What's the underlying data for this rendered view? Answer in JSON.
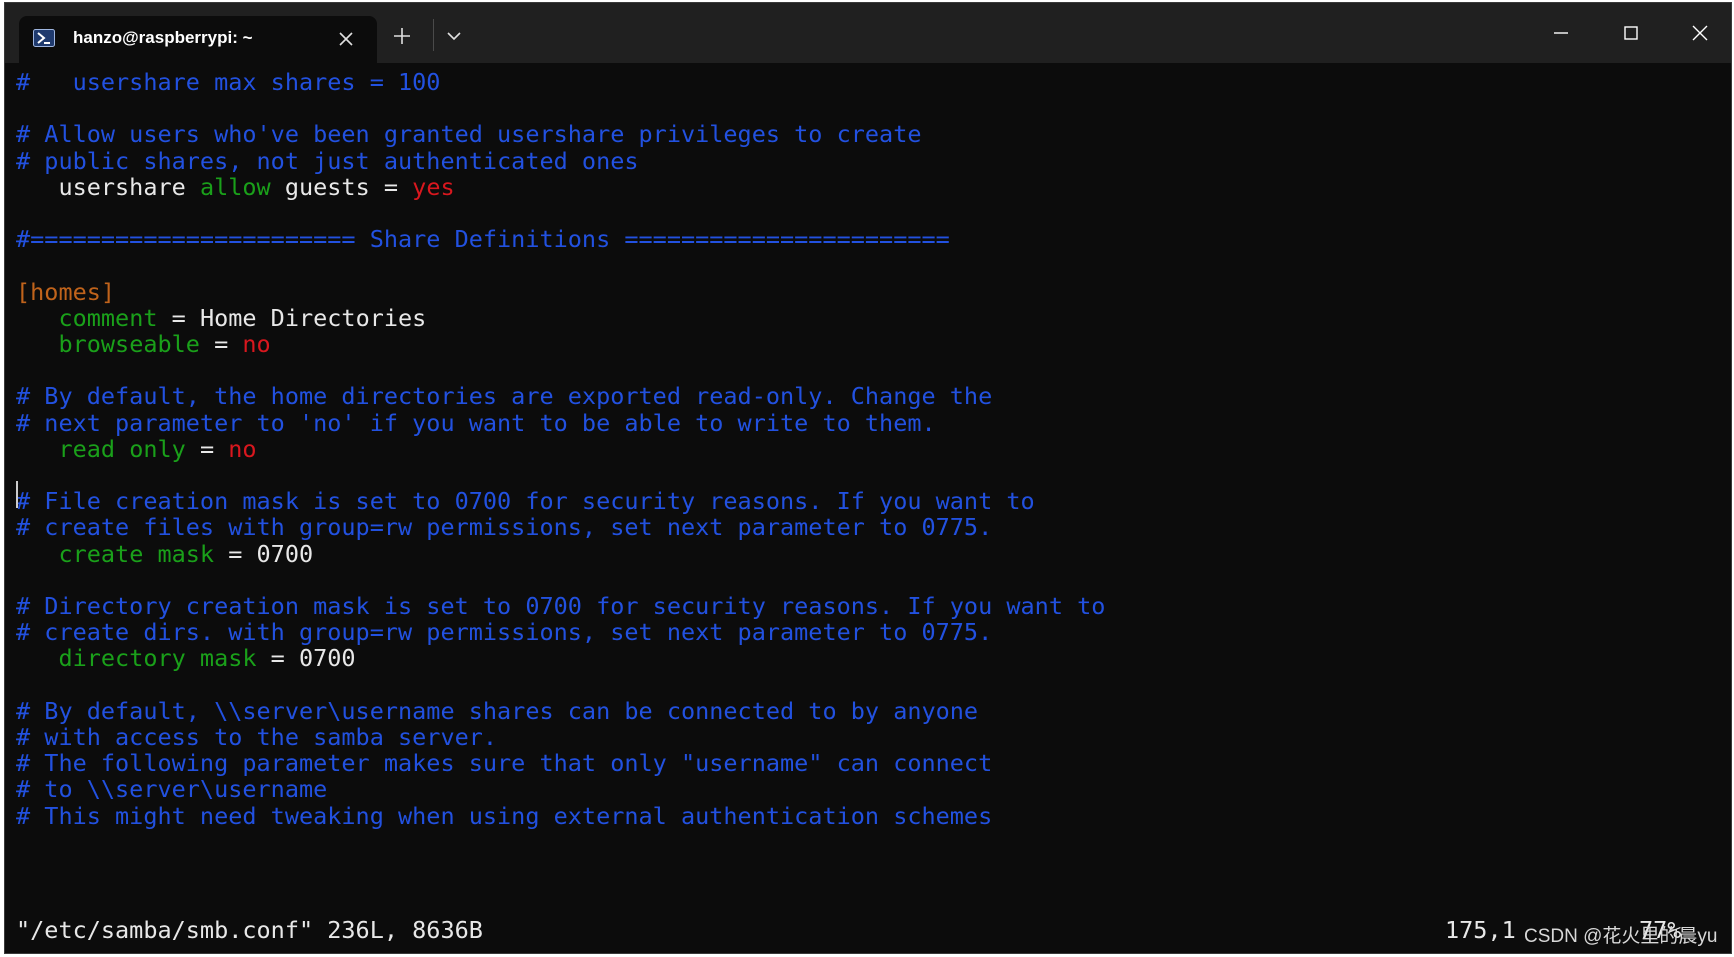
{
  "tab": {
    "title": "hanzo@raspberrypi: ~",
    "icon": "powershell-icon"
  },
  "colors": {
    "background": "#0c0c0c",
    "titlebar": "#202020",
    "comment": "#2251e0",
    "keyword_green": "#1aa01a",
    "value_red": "#d9171e",
    "section_orange": "#c0631b",
    "text": "#e8e8e8"
  },
  "lines": [
    [
      {
        "t": "#   usershare max shares = 100",
        "c": "comment"
      }
    ],
    [],
    [
      {
        "t": "# Allow users who've been granted usershare privileges to create",
        "c": "comment"
      }
    ],
    [
      {
        "t": "# public shares, not just authenticated ones",
        "c": "comment"
      }
    ],
    [
      {
        "t": "   usershare ",
        "c": "text"
      },
      {
        "t": "allow",
        "c": "key"
      },
      {
        "t": " guests = ",
        "c": "text"
      },
      {
        "t": "yes",
        "c": "red"
      }
    ],
    [],
    [
      {
        "t": "#======================= Share Definitions =======================",
        "c": "comment"
      }
    ],
    [],
    [
      {
        "t": "[homes]",
        "c": "section"
      }
    ],
    [
      {
        "t": "   ",
        "c": "text"
      },
      {
        "t": "comment",
        "c": "key"
      },
      {
        "t": " = Home Directories",
        "c": "text"
      }
    ],
    [
      {
        "t": "   ",
        "c": "text"
      },
      {
        "t": "browseable",
        "c": "key"
      },
      {
        "t": " = ",
        "c": "text"
      },
      {
        "t": "no",
        "c": "red"
      }
    ],
    [],
    [
      {
        "t": "# By default, the home directories are exported read-only. Change the",
        "c": "comment"
      }
    ],
    [
      {
        "t": "# next parameter to 'no' if you want to be able to write to them.",
        "c": "comment"
      }
    ],
    [
      {
        "t": "   ",
        "c": "text"
      },
      {
        "t": "read only",
        "c": "key"
      },
      {
        "t": " = ",
        "c": "text"
      },
      {
        "t": "no",
        "c": "red"
      }
    ],
    [],
    [
      {
        "t": "# File creation mask is set to 0700 for security reasons. If you want to",
        "c": "comment"
      }
    ],
    [
      {
        "t": "# create files with group=rw permissions, set next parameter to 0775.",
        "c": "comment"
      }
    ],
    [
      {
        "t": "   ",
        "c": "text"
      },
      {
        "t": "create mask",
        "c": "key"
      },
      {
        "t": " = 0700",
        "c": "text"
      }
    ],
    [],
    [
      {
        "t": "# Directory creation mask is set to 0700 for security reasons. If you want to",
        "c": "comment"
      }
    ],
    [
      {
        "t": "# create dirs. with group=rw permissions, set next parameter to 0775.",
        "c": "comment"
      }
    ],
    [
      {
        "t": "   ",
        "c": "text"
      },
      {
        "t": "directory mask",
        "c": "key"
      },
      {
        "t": " = 0700",
        "c": "text"
      }
    ],
    [],
    [
      {
        "t": "# By default, \\\\server\\username shares can be connected to by anyone",
        "c": "comment"
      }
    ],
    [
      {
        "t": "# with access to the samba server.",
        "c": "comment"
      }
    ],
    [
      {
        "t": "# The following parameter makes sure that only \"username\" can connect",
        "c": "comment"
      }
    ],
    [
      {
        "t": "# to \\\\server\\username",
        "c": "comment"
      }
    ],
    [
      {
        "t": "# This might need tweaking when using external authentication schemes",
        "c": "comment"
      }
    ]
  ],
  "status": {
    "file_info": "\"/etc/samba/smb.conf\" 236L, 8636B",
    "position": "175,1",
    "percent": "77%"
  },
  "watermark": "CSDN @花火里的晨yu"
}
